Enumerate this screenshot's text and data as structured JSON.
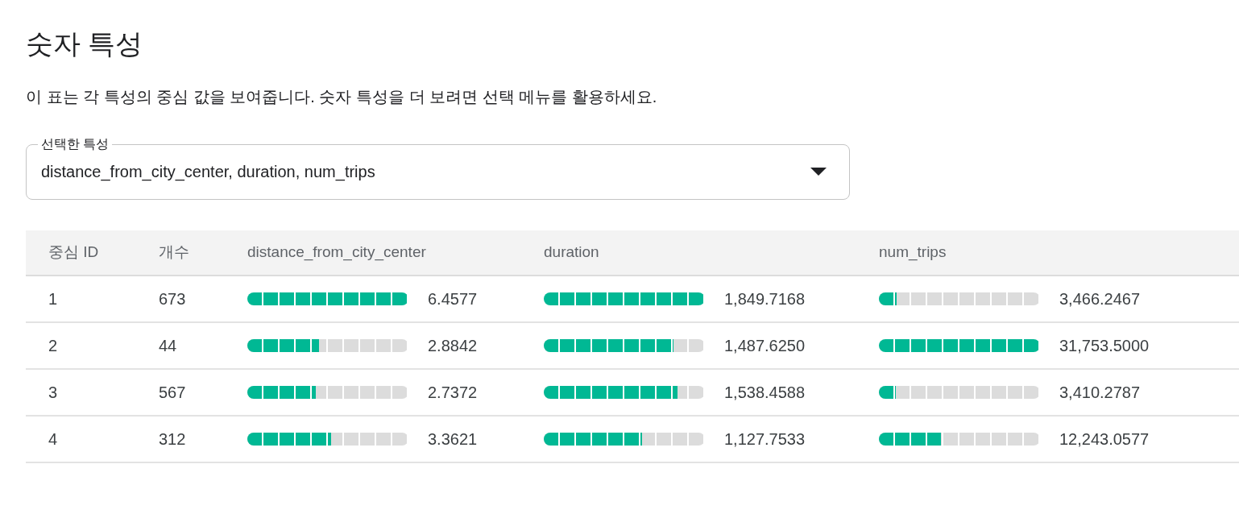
{
  "title": "숫자 특성",
  "description": "이 표는 각 특성의 중심 값을 보여줍니다. 숫자 특성을 더 보려면 선택 메뉴를 활용하세요.",
  "select": {
    "label": "선택한 특성",
    "value": "distance_from_city_center, duration, num_trips"
  },
  "table": {
    "columns": [
      "중심 ID",
      "개수",
      "distance_from_city_center",
      "duration",
      "num_trips"
    ],
    "rows": [
      {
        "id": "1",
        "count": "673",
        "cells": [
          {
            "level": 1.0,
            "value": "6.4577"
          },
          {
            "level": 1.0,
            "value": "1,849.7168"
          },
          {
            "level": 0.109,
            "value": "3,466.2467"
          }
        ]
      },
      {
        "id": "2",
        "count": "44",
        "cells": [
          {
            "level": 0.447,
            "value": "2.8842"
          },
          {
            "level": 0.804,
            "value": "1,487.6250"
          },
          {
            "level": 1.0,
            "value": "31,753.5000"
          }
        ]
      },
      {
        "id": "3",
        "count": "567",
        "cells": [
          {
            "level": 0.424,
            "value": "2.7372"
          },
          {
            "level": 0.832,
            "value": "1,538.4588"
          },
          {
            "level": 0.107,
            "value": "3,410.2787"
          }
        ]
      },
      {
        "id": "4",
        "count": "312",
        "cells": [
          {
            "level": 0.521,
            "value": "3.3621"
          },
          {
            "level": 0.61,
            "value": "1,127.7533"
          },
          {
            "level": 0.386,
            "value": "12,243.0577"
          }
        ]
      }
    ]
  }
}
